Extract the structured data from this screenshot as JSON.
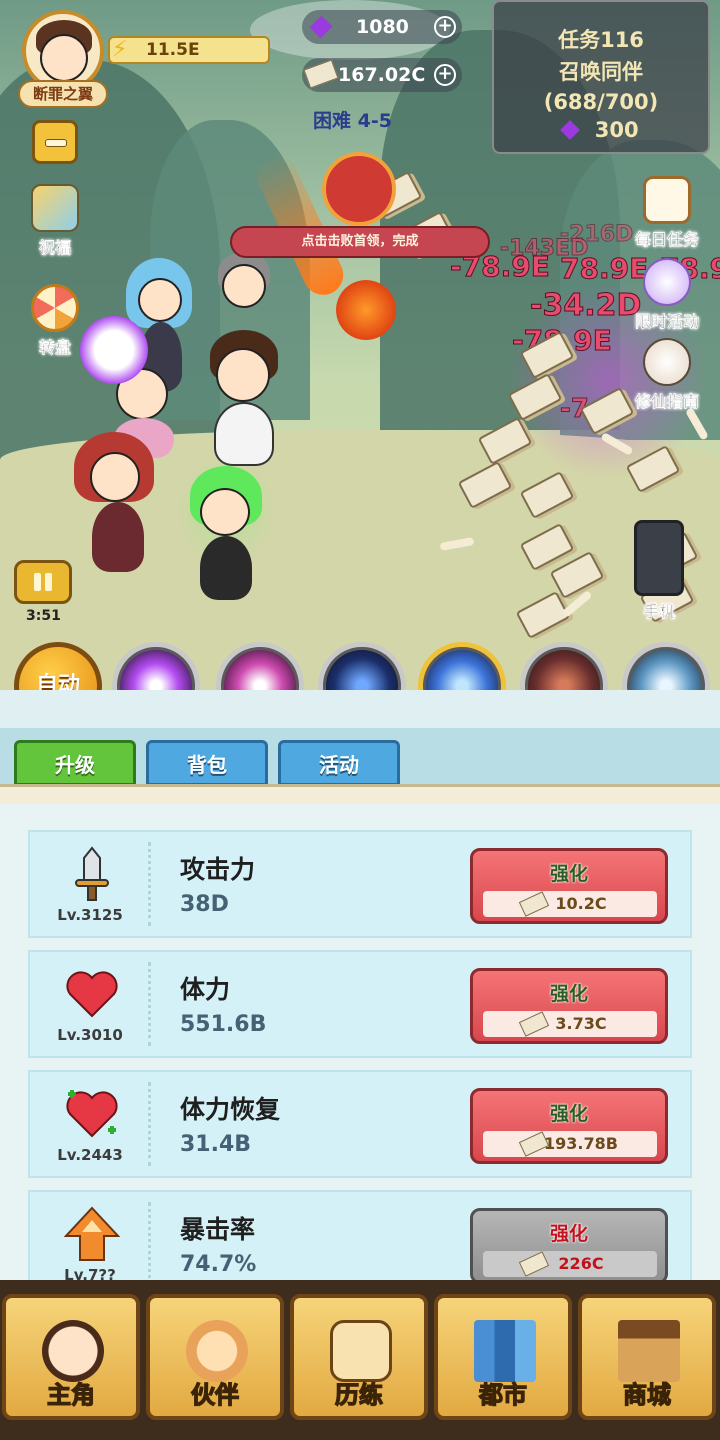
{
  "player": {
    "name": "断罪之翼",
    "power": "11.5E"
  },
  "resources": {
    "gems": "1080",
    "coins": "167.02C",
    "difficulty": "困难 4-5"
  },
  "quest": {
    "title": "任务116",
    "name": "召唤同伴",
    "progress": "(688/700)",
    "reward": "300"
  },
  "side_left": {
    "bless": "祝福",
    "wheel": "转盘"
  },
  "side_right": {
    "daily": "每日任务",
    "limited": "限时活动",
    "guide": "修仙指南",
    "phone": "手机"
  },
  "boss_banner": "点击击败首领，完成",
  "damage_numbers": [
    "-78.9E",
    "78.9E",
    "78.9",
    "-34.2D",
    "-78.9E",
    "-7",
    "-216D",
    "-143ED"
  ],
  "timer": "3:51",
  "auto_label": "自动",
  "tabs": [
    "升级",
    "背包",
    "活动"
  ],
  "upgrades": [
    {
      "name": "攻击力",
      "value": "38D",
      "level": "Lv.3125",
      "button": "强化",
      "cost": "10.2C",
      "icon": "sword-icon",
      "enabled": true
    },
    {
      "name": "体力",
      "value": "551.6B",
      "level": "Lv.3010",
      "button": "强化",
      "cost": "3.73C",
      "icon": "heart-icon",
      "enabled": true
    },
    {
      "name": "体力恢复",
      "value": "31.4B",
      "level": "Lv.2443",
      "button": "强化",
      "cost": "193.78B",
      "icon": "heart-plus-icon",
      "enabled": true
    },
    {
      "name": "暴击率",
      "value": "74.7%",
      "level": "Lv.7??",
      "button": "强化",
      "cost": "226C",
      "icon": "crit-arrow-icon",
      "enabled": false
    }
  ],
  "nav": [
    {
      "label": "主角",
      "icon": "hero-icon"
    },
    {
      "label": "伙伴",
      "icon": "cat-icon"
    },
    {
      "label": "历练",
      "icon": "tablet-icon"
    },
    {
      "label": "都市",
      "icon": "city-icon"
    },
    {
      "label": "商城",
      "icon": "shop-stall-icon"
    }
  ],
  "colors": {
    "accent_gold": "#e48a11",
    "tab_active": "#63c53c",
    "tab_inactive": "#4fa9e0",
    "upgrade_button": "#d9474e",
    "damage": "#e84b6b"
  }
}
